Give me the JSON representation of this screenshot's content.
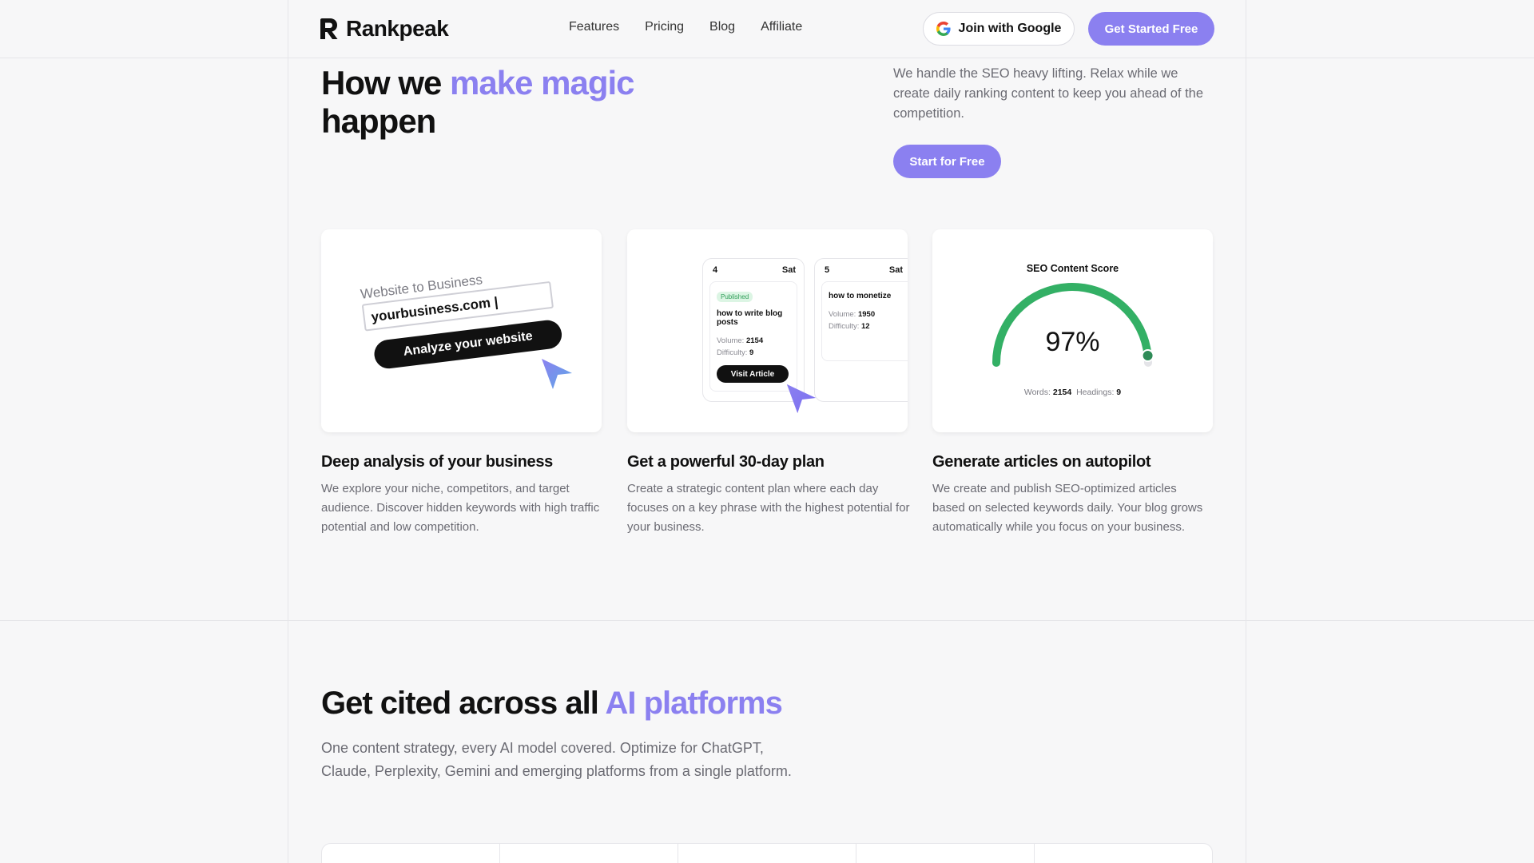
{
  "nav": {
    "brand": "Rankpeak",
    "links": [
      "Features",
      "Pricing",
      "Blog",
      "Affiliate"
    ],
    "google_button": "Join with Google",
    "cta_button": "Get Started Free"
  },
  "hero": {
    "title_part1": "How we ",
    "title_accent": "make magic",
    "title_part2": "happen",
    "description": "We handle the SEO heavy lifting. Relax while we create daily ranking content to keep you ahead of the competition.",
    "cta": "Start for Free"
  },
  "features": [
    {
      "title": "Deep analysis of your business",
      "description": "We explore your niche, competitors, and target audience. Discover hidden keywords with high traffic potential and low competition.",
      "illustration": {
        "label": "Website to Business",
        "input_value": "yourbusiness.com",
        "button": "Analyze your website"
      }
    },
    {
      "title": "Get a powerful 30-day plan",
      "description": "Create a strategic content plan where each day focuses on a key phrase with the highest potential for your business.",
      "illustration": {
        "days": [
          {
            "day": "4",
            "weekday": "Sat",
            "badge": "Published",
            "keyword": "how to write blog posts",
            "volume_label": "Volume:",
            "volume": "2154",
            "difficulty_label": "Difficulty:",
            "difficulty": "9",
            "button": "Visit Article"
          },
          {
            "day": "5",
            "weekday": "Sat",
            "keyword": "how to monetize",
            "volume_label": "Volume:",
            "volume": "1950",
            "difficulty_label": "Difficulty:",
            "difficulty": "12"
          }
        ]
      }
    },
    {
      "title": "Generate articles on autopilot",
      "description": "We create and publish SEO-optimized articles based on selected keywords daily. Your blog grows automatically while you focus on your business.",
      "illustration": {
        "title": "SEO Content Score",
        "score": "97%",
        "score_value": 0.97,
        "words_label": "Words:",
        "words": "2154",
        "headings_label": "Headings:",
        "headings": "9",
        "gauge_color": "#33b065"
      }
    }
  ],
  "section2": {
    "title_part1": "Get cited across all ",
    "title_accent": "AI platforms",
    "description": "One content strategy, every AI model covered. Optimize for ChatGPT, Claude, Perplexity, Gemini and emerging platforms from a single platform."
  },
  "colors": {
    "accent": "#8b80f0",
    "background": "#f7f7f8",
    "text_muted": "#6b6b73"
  }
}
